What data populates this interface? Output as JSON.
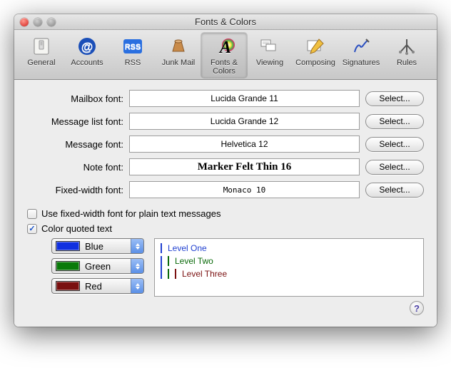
{
  "window": {
    "title": "Fonts & Colors"
  },
  "toolbar": {
    "items": [
      {
        "label": "General"
      },
      {
        "label": "Accounts"
      },
      {
        "label": "RSS"
      },
      {
        "label": "Junk Mail"
      },
      {
        "label": "Fonts & Colors"
      },
      {
        "label": "Viewing"
      },
      {
        "label": "Composing"
      },
      {
        "label": "Signatures"
      },
      {
        "label": "Rules"
      }
    ],
    "selected_index": 4
  },
  "font_rows": [
    {
      "label": "Mailbox font:",
      "value": "Lucida Grande 11",
      "select": "Select..."
    },
    {
      "label": "Message list font:",
      "value": "Lucida Grande 12",
      "select": "Select..."
    },
    {
      "label": "Message font:",
      "value": "Helvetica 12",
      "select": "Select..."
    },
    {
      "label": "Note font:",
      "value": "Marker Felt Thin 16",
      "select": "Select..."
    },
    {
      "label": "Fixed-width font:",
      "value": "Monaco 10",
      "select": "Select..."
    }
  ],
  "checkboxes": {
    "fixed_width": {
      "label": "Use fixed-width font for plain text messages",
      "checked": false
    },
    "color_quoted": {
      "label": "Color quoted text",
      "checked": true
    }
  },
  "color_popups": [
    {
      "name": "Blue",
      "color": "#1030e0"
    },
    {
      "name": "Green",
      "color": "#0a7a0a"
    },
    {
      "name": "Red",
      "color": "#7a1010"
    }
  ],
  "quote_preview": {
    "level1": "Level One",
    "level2": "Level Two",
    "level3": "Level Three"
  },
  "help_glyph": "?"
}
